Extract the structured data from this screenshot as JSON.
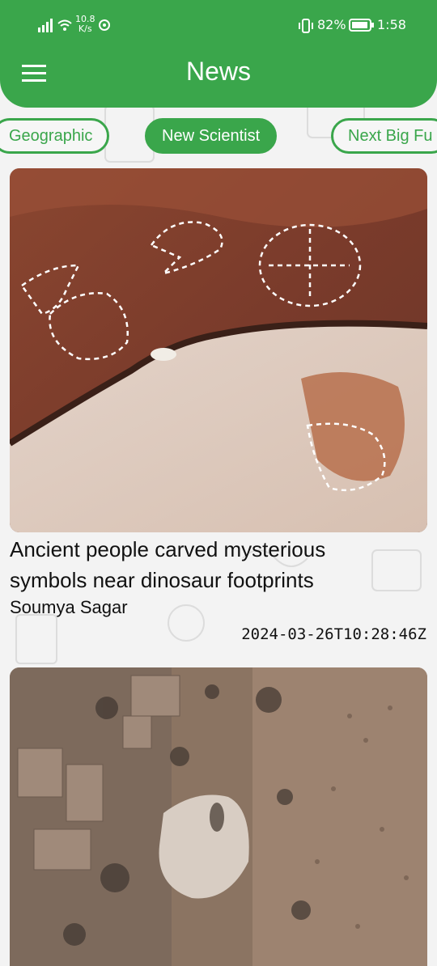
{
  "status_bar": {
    "net_speed_value": "10.8",
    "net_speed_unit": "K/s",
    "battery_percent": "82%",
    "time": "1:58"
  },
  "header": {
    "title": "News",
    "menu_icon": "hamburger-menu-icon"
  },
  "tabs": [
    {
      "label": "Geographic",
      "active": false
    },
    {
      "label": "New Scientist",
      "active": true
    },
    {
      "label": "Next Big Fu",
      "active": false
    }
  ],
  "articles": [
    {
      "image": "rock-carvings-photo",
      "headline_line1": "Ancient people carved mysterious",
      "headline_line2": "symbols near dinosaur footprints",
      "author": "Soumya Sagar",
      "published": "2024-03-26T10:28:46Z"
    },
    {
      "image": "aerial-landscape-photo"
    }
  ],
  "colors": {
    "accent": "#3aa64b",
    "background": "#f3f3f3"
  }
}
